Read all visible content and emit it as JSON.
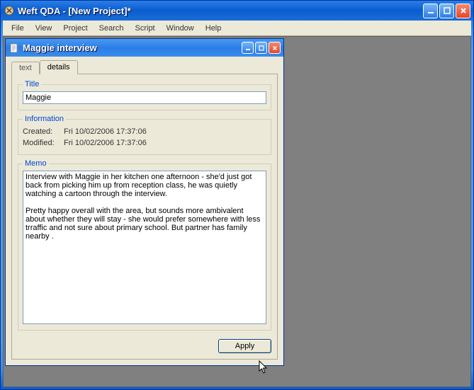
{
  "main": {
    "title": "Weft QDA - [New Project]*",
    "menus": [
      "File",
      "View",
      "Project",
      "Search",
      "Script",
      "Window",
      "Help"
    ]
  },
  "child": {
    "title": "Maggie interview",
    "tabs": {
      "text": "text",
      "details": "details"
    },
    "fieldsets": {
      "title_legend": "Title",
      "title_value": "Maggie",
      "info_legend": "Information",
      "created_label": "Created:",
      "created_value": "Fri 10/02/2006 17:37:06",
      "modified_label": "Modified:",
      "modified_value": "Fri 10/02/2006 17:37:06",
      "memo_legend": "Memo",
      "memo_value": "Interview with Maggie in her kitchen one afternoon - she'd just got back from picking him up from reception class, he was quietly watching a cartoon through the interview.\n\nPretty happy overall with the area, but sounds more ambivalent about whether they will stay - she would prefer somewhere with less trraffic and not sure about primary school. But partner has family nearby ."
    },
    "buttons": {
      "apply": "Apply"
    }
  }
}
